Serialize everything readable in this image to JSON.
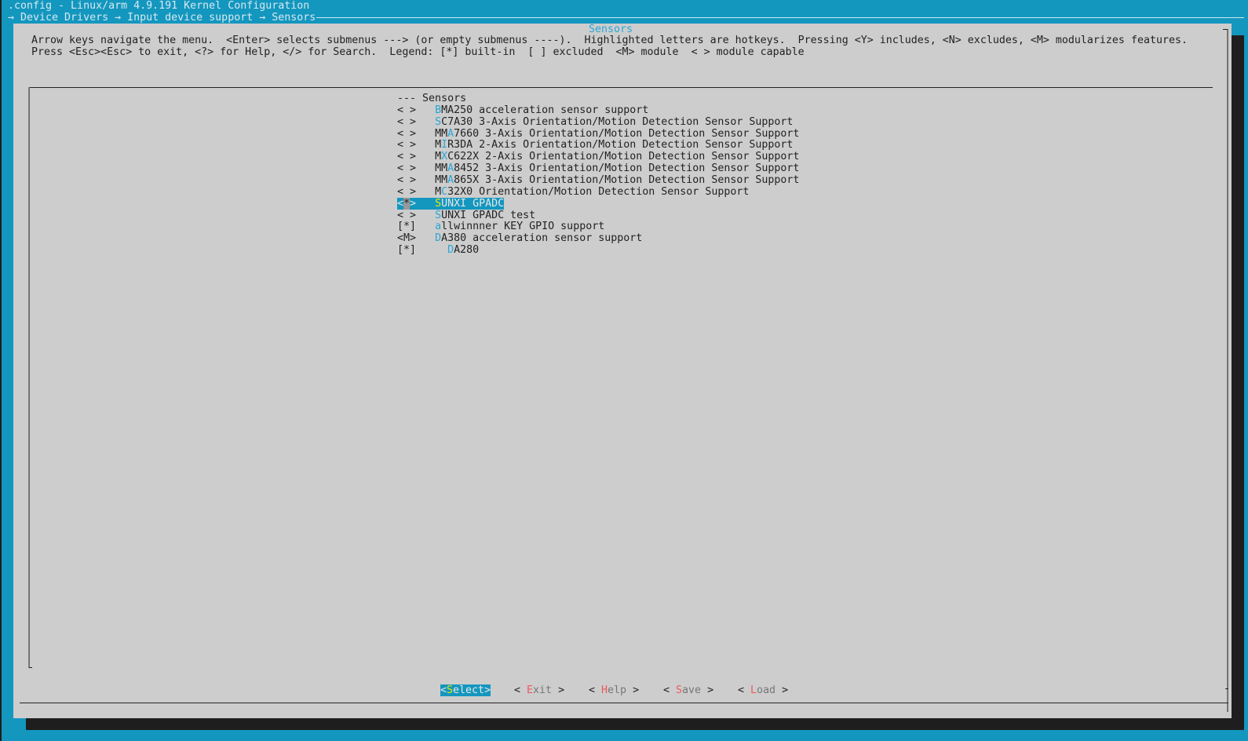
{
  "header": {
    "title": ".config - Linux/arm 4.9.191 Kernel Configuration",
    "breadcrumb": "→ Device Drivers → Input device support → Sensors"
  },
  "dialog": {
    "title": "Sensors",
    "help_line1": "Arrow keys navigate the menu.  <Enter> selects submenus ---> (or empty submenus ----).  Highlighted letters are hotkeys.  Pressing <Y> includes, <N> excludes, <M> modularizes features.",
    "help_line2": "Press <Esc><Esc> to exit, <?> for Help, </> for Search.  Legend: [*] built-in  [ ] excluded  <M> module  < > module capable"
  },
  "menu": {
    "items": [
      {
        "prefix": "---",
        "indent": " ",
        "pre": "",
        "hotkey": "",
        "post": "Sensors",
        "selected": false
      },
      {
        "prefix": "< >",
        "indent": "   ",
        "pre": "",
        "hotkey": "B",
        "post": "MA250 acceleration sensor support",
        "selected": false
      },
      {
        "prefix": "< >",
        "indent": "   ",
        "pre": "",
        "hotkey": "S",
        "post": "C7A30 3-Axis Orientation/Motion Detection Sensor Support",
        "selected": false
      },
      {
        "prefix": "< >",
        "indent": "   ",
        "pre": "MM",
        "hotkey": "A",
        "post": "7660 3-Axis Orientation/Motion Detection Sensor Support",
        "selected": false
      },
      {
        "prefix": "< >",
        "indent": "   ",
        "pre": "M",
        "hotkey": "I",
        "post": "R3DA 2-Axis Orientation/Motion Detection Sensor Support",
        "selected": false
      },
      {
        "prefix": "< >",
        "indent": "   ",
        "pre": "M",
        "hotkey": "X",
        "post": "C622X 2-Axis Orientation/Motion Detection Sensor Support",
        "selected": false
      },
      {
        "prefix": "< >",
        "indent": "   ",
        "pre": "MM",
        "hotkey": "A",
        "post": "8452 3-Axis Orientation/Motion Detection Sensor Support",
        "selected": false
      },
      {
        "prefix": "< >",
        "indent": "   ",
        "pre": "MM",
        "hotkey": "A",
        "post": "865X 3-Axis Orientation/Motion Detection Sensor Support",
        "selected": false
      },
      {
        "prefix": "< >",
        "indent": "   ",
        "pre": "M",
        "hotkey": "C",
        "post": "32X0 Orientation/Motion Detection Sensor Support",
        "selected": false
      },
      {
        "prefix": "<*>",
        "indent": "   ",
        "pre": "",
        "hotkey": "S",
        "post": "UNXI GPADC",
        "selected": true
      },
      {
        "prefix": "< >",
        "indent": "   ",
        "pre": "",
        "hotkey": "S",
        "post": "UNXI GPADC test",
        "selected": false
      },
      {
        "prefix": "[*]",
        "indent": "   ",
        "pre": "",
        "hotkey": "a",
        "post": "llwinnner KEY GPIO support",
        "selected": false
      },
      {
        "prefix": "<M>",
        "indent": "   ",
        "pre": "",
        "hotkey": "D",
        "post": "A380 acceleration sensor support",
        "selected": false
      },
      {
        "prefix": "[*]",
        "indent": "     ",
        "pre": "",
        "hotkey": "D",
        "post": "A280",
        "selected": false
      }
    ]
  },
  "buttons": [
    {
      "left": "<",
      "hotkey": "S",
      "rest": "elect",
      "right": ">",
      "selected": true
    },
    {
      "left": "< ",
      "hotkey": "E",
      "rest": "xit",
      "right": " >",
      "selected": false
    },
    {
      "left": "< ",
      "hotkey": "H",
      "rest": "elp",
      "right": " >",
      "selected": false
    },
    {
      "left": "< ",
      "hotkey": "S",
      "rest": "ave",
      "right": " >",
      "selected": false
    },
    {
      "left": "< ",
      "hotkey": "L",
      "rest": "oad",
      "right": " >",
      "selected": false
    }
  ],
  "colors": {
    "background": "#1397bf",
    "dialog": "#cdcdcd",
    "hotkey": "#2aa6d6",
    "button_hotkey": "#f05a5a",
    "selected_hotkey": "#e8e800"
  }
}
